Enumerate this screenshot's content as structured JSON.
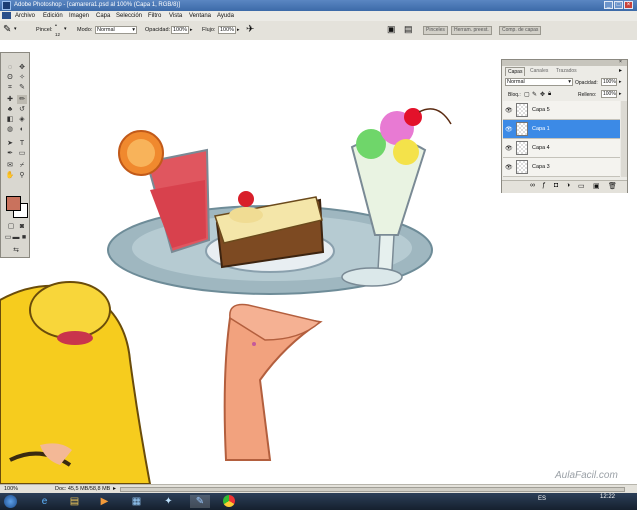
{
  "window": {
    "title": "Adobe Photoshop - [camarera1.psd al 100% (Capa 1, RGB/8)]",
    "buttons": [
      "_",
      "□",
      "×"
    ]
  },
  "menu": [
    "Archivo",
    "Edición",
    "Imagen",
    "Capa",
    "Selección",
    "Filtro",
    "Vista",
    "Ventana",
    "Ayuda"
  ],
  "options": {
    "brush_label": "Pincel:",
    "brush_size": "12",
    "mode_label": "Modo:",
    "mode_value": "Normal",
    "opacity_label": "Opacidad:",
    "opacity_value": "100%",
    "flow_label": "Flujo:",
    "flow_value": "100%"
  },
  "dock_tabs": [
    "Pinceles",
    "Herram. preest.",
    "Comp. de capas"
  ],
  "layers_panel": {
    "tabs": [
      "Capas",
      "Canales",
      "Trazados"
    ],
    "blend_mode": "Normal",
    "opacity_label": "Opacidad:",
    "opacity_value": "100%",
    "lock_label": "Bloq.:",
    "fill_label": "Relleno:",
    "fill_value": "100%",
    "layers": [
      {
        "name": "Capa 5",
        "selected": false
      },
      {
        "name": "Capa 1",
        "selected": true
      },
      {
        "name": "Capa 4",
        "selected": false
      },
      {
        "name": "Capa 3",
        "selected": false
      }
    ]
  },
  "status": {
    "zoom": "100%",
    "doc": "Doc: 45,5 MB/58,8 MB"
  },
  "taskbar": {
    "language": "ES",
    "time": "12:22",
    "icons": [
      "start-orb",
      "internet-explorer",
      "file-explorer",
      "media-player",
      "photoshop-thumb",
      "network-app",
      "photoshop-active",
      "chrome"
    ]
  },
  "colors": {
    "foreground": "#c9725d",
    "background": "#ffffff",
    "selected_layer": "#3c8ae6"
  }
}
